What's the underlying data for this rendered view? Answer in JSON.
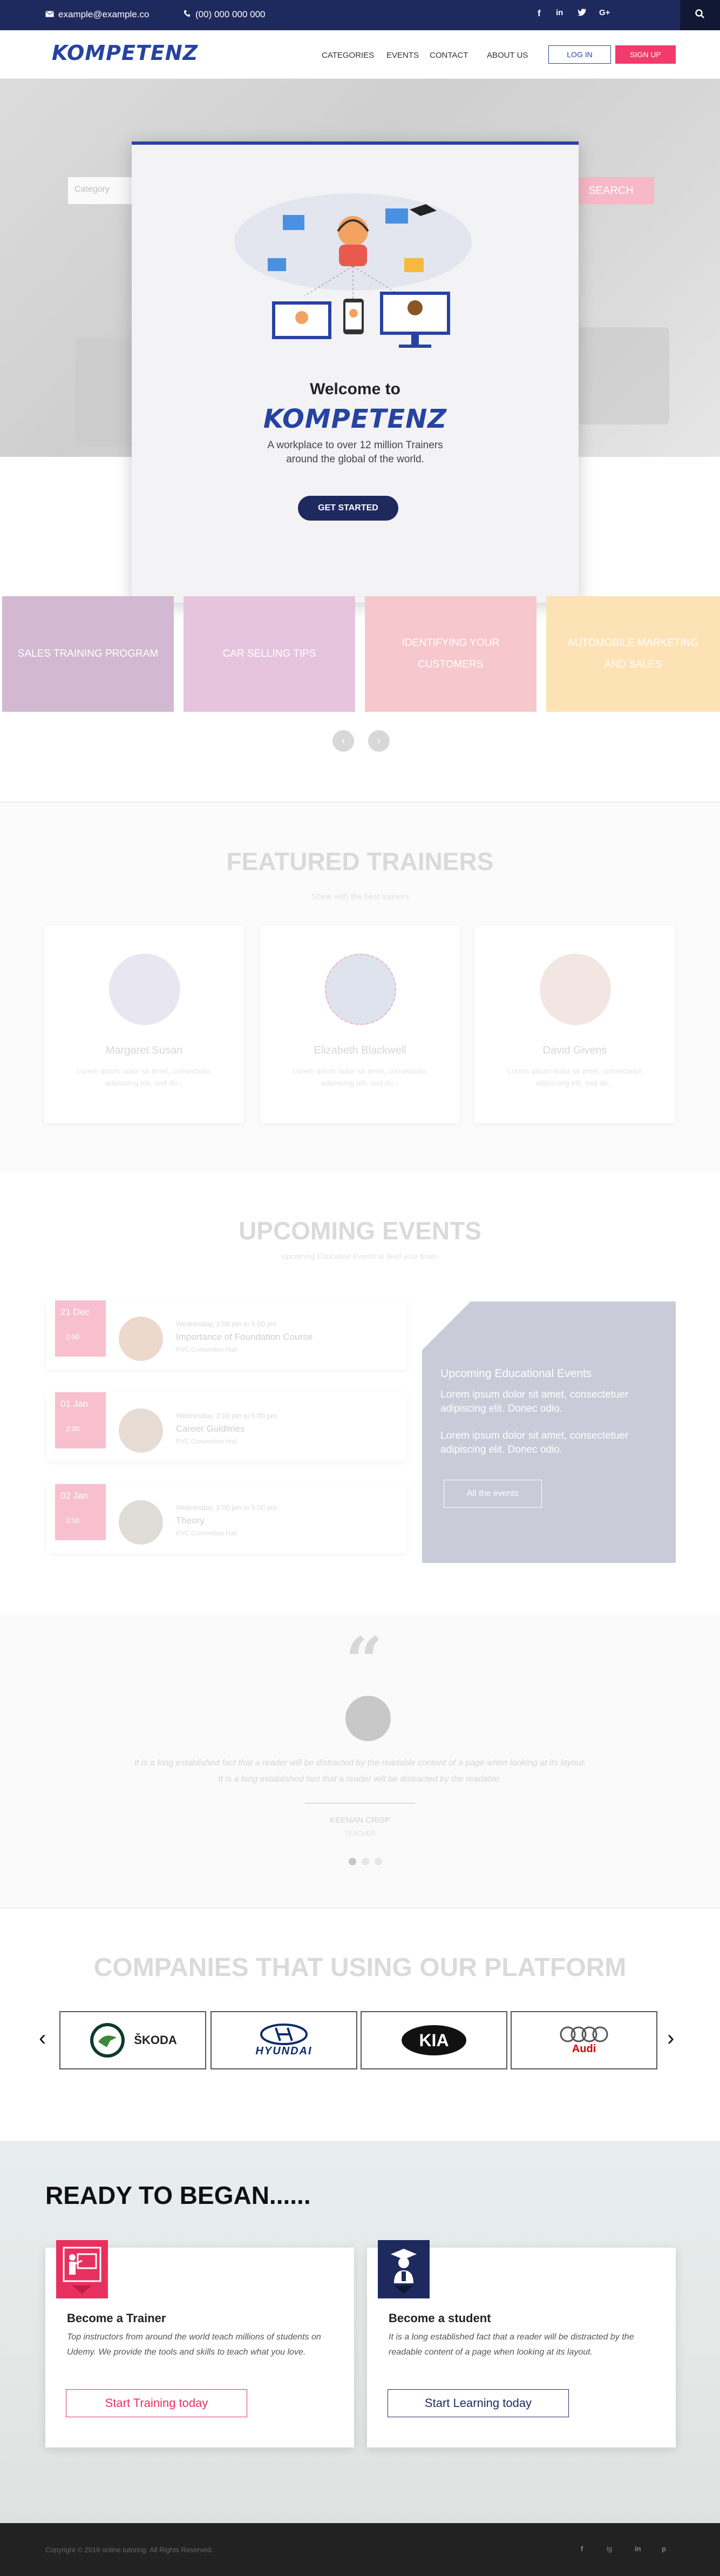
{
  "topbar": {
    "email": "example@example.co",
    "phone": "(00) 000 000 000",
    "social": [
      "f",
      "in",
      "t",
      "G+"
    ]
  },
  "nav": {
    "logo": "KOMPETENZ",
    "menu": [
      "CATEGORIES",
      "EVENTS",
      "CONTACT",
      "ABOUT US"
    ],
    "login": "LOG IN",
    "signup": "SIGN UP"
  },
  "hero": {
    "search_placeholder": "Category",
    "search_button": "SEARCH"
  },
  "modal": {
    "welcome": "Welcome to",
    "logo": "KOMPETENZ",
    "tagline_line1": "A workplace to over 12 million Trainers",
    "tagline_line2": "around the global of the world.",
    "cta": "GET STARTED"
  },
  "categories": [
    {
      "label": "SALES TRAINING PROGRAM",
      "color": "#d3b8d2"
    },
    {
      "label": "CAR SELLING TIPS",
      "color": "#e7c4de"
    },
    {
      "label": "IDENTIFYING YOUR CUSTOMERS",
      "color": "#f6c7cc"
    },
    {
      "label": "AUTOMOBILE MARKETING AND SALES",
      "color": "#fce2b5"
    }
  ],
  "trainers": {
    "title": "FEATURED TRAINERS",
    "subtitle": "Shine with the best trainers",
    "items": [
      {
        "name": "Margaret Susan",
        "desc": "Lorem ipsum dolor sit amet, consectetur adipiscing elit, sed do..."
      },
      {
        "name": "Elizabeth Blackwell",
        "desc": "Lorem ipsum dolor sit amet, consectetur adipiscing elit, sed do..."
      },
      {
        "name": "David Givens",
        "desc": "Lorem ipsum dolor sit amet, consectetur adipiscing elit, sed do..."
      }
    ]
  },
  "events": {
    "title": "UPCOMING EVENTS",
    "subtitle": "Upcoming Education Events to feed your brain.",
    "items": [
      {
        "date": "21 Dec",
        "time_badge": "2:00",
        "time": "Wednesday, 2:00 pm to 5:00 pm",
        "title": "Importance of Foundation Course",
        "location": "PVC Convention Hall"
      },
      {
        "date": "01 Jan",
        "time_badge": "2:00",
        "time": "Wednesday, 2:00 pm to 5:00 pm",
        "title": "Career Guidlines",
        "location": "PVC Convention Hall"
      },
      {
        "date": "02 Jan",
        "time_badge": "2:00",
        "time": "Wednesday, 2:00 pm to 5:00 pm",
        "title": "Theory",
        "location": "PVC Convention Hall"
      }
    ],
    "panel": {
      "title": "Upcoming Educational Events",
      "para1": "Lorem ipsum dolor sit amet, consectetuer adipiscing elit. Donec odio.",
      "para2": "Lorem ipsum dolor sit amet, consectetuer adipiscing elit. Donec odio.",
      "button": "All the events"
    }
  },
  "testimonial": {
    "text1": "It is a long established fact that a reader will be distracted by the readable content of a page when looking at its layout.",
    "text2": "It is a long established fact that a reader will be distracted by the readable.",
    "name": "KEENAN CRISP",
    "role": "TEACHER"
  },
  "companies": {
    "title": "COMPANIES THAT USING OUR PLATFORM",
    "items": [
      "ŠKODA",
      "HYUNDAI",
      "KIA",
      "Audi"
    ]
  },
  "ready": {
    "title": "READY TO BEGAN......",
    "trainer": {
      "title": "Become a Trainer",
      "desc": "Top instructors from around the world teach millions of students on Udemy. We provide the tools and skills to teach what you love.",
      "button": "Start Training today"
    },
    "student": {
      "title": "Become a student",
      "desc": "It is a long established fact that a reader will be distracted by the readable content of a page when looking at its layout.",
      "button": "Start Learning today"
    }
  },
  "footer": {
    "copyright": "Copyright © 2019 online tutoring. All Rights Reserved.",
    "social": [
      "f",
      "ig",
      "in",
      "p"
    ]
  },
  "colors": {
    "brand": "#2743a0",
    "accent": "#f23a6b",
    "navy": "#1e2a5e"
  }
}
